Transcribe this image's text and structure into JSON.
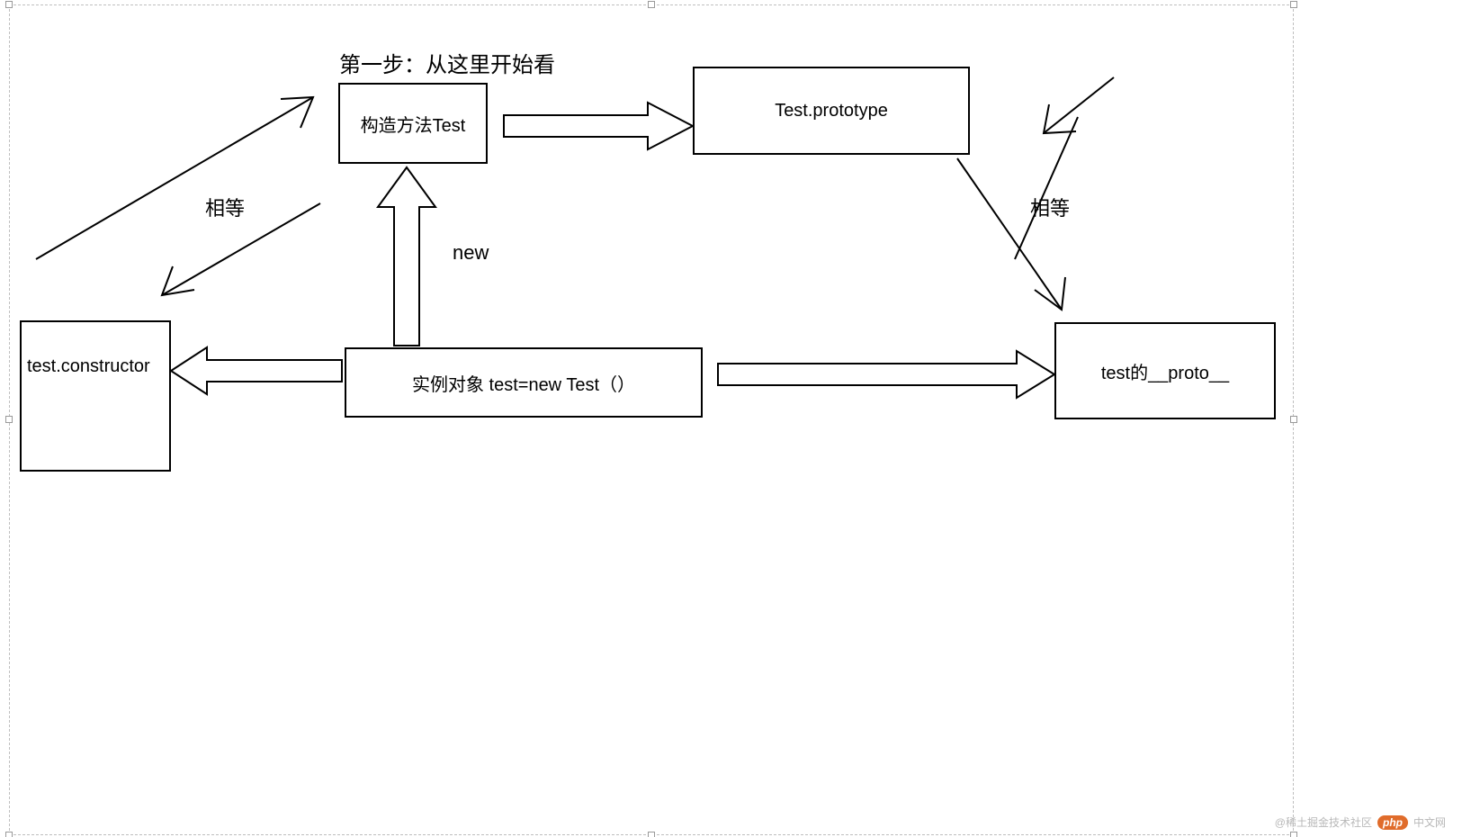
{
  "title_label": "第一步：从这里开始看",
  "boxes": {
    "constructor_fn": "构造方法Test",
    "prototype": "Test.prototype",
    "instance": "实例对象 test=new Test（）",
    "instance_constructor": "test.constructor",
    "instance_proto": "test的__proto__"
  },
  "edge_labels": {
    "equal_left": "相等",
    "equal_right": "相等",
    "new_label": "new"
  },
  "watermark": {
    "left": "@稀土掘金技术社区",
    "badge": "php",
    "right": "中文网"
  }
}
